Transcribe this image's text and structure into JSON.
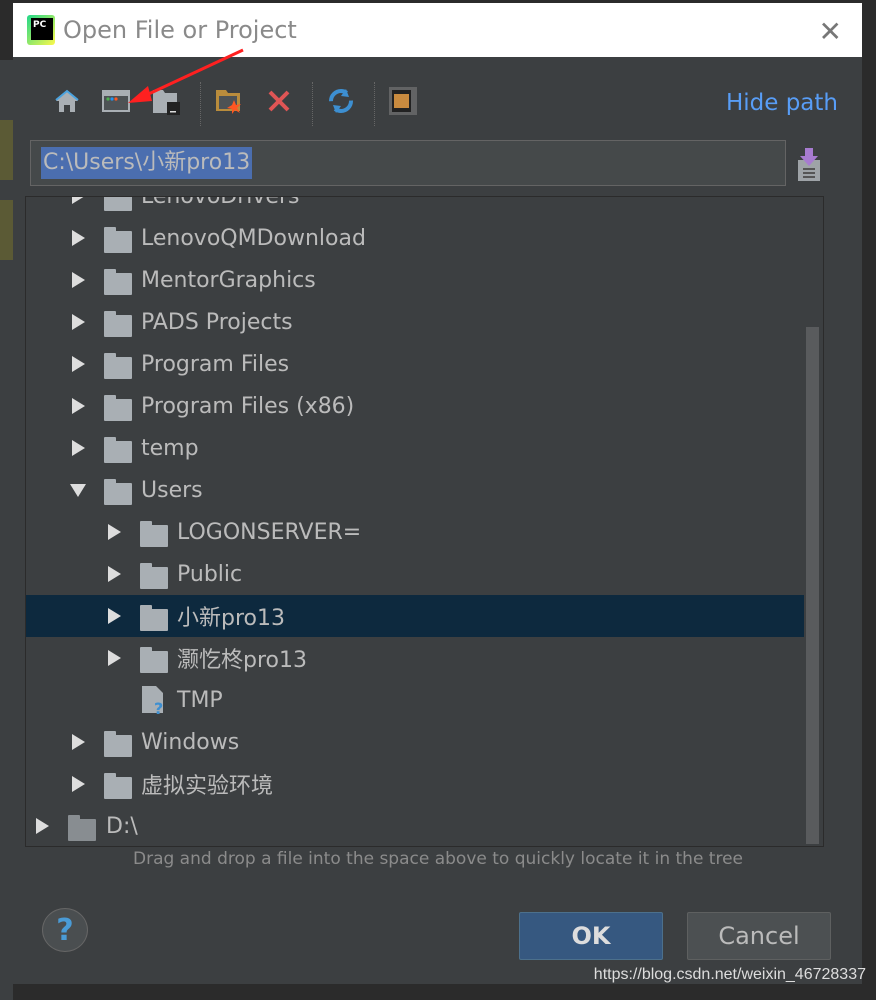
{
  "dialog": {
    "title": "Open File or Project",
    "close_icon": "close-icon"
  },
  "toolbar": {
    "hide_path_label": "Hide path",
    "buttons": [
      "home",
      "desktop",
      "project-folder",
      "new-folder",
      "delete",
      "refresh",
      "show-hidden"
    ]
  },
  "path": {
    "value": "C:\\Users\\小新pro13"
  },
  "tree": {
    "rows": [
      {
        "label": "LenovoDrivers",
        "level": 1,
        "expanded": false,
        "type": "folder"
      },
      {
        "label": "LenovoQMDownload",
        "level": 1,
        "expanded": false,
        "type": "folder"
      },
      {
        "label": "MentorGraphics",
        "level": 1,
        "expanded": false,
        "type": "folder"
      },
      {
        "label": "PADS Projects",
        "level": 1,
        "expanded": false,
        "type": "folder"
      },
      {
        "label": "Program Files",
        "level": 1,
        "expanded": false,
        "type": "folder"
      },
      {
        "label": "Program Files (x86)",
        "level": 1,
        "expanded": false,
        "type": "folder"
      },
      {
        "label": "temp",
        "level": 1,
        "expanded": false,
        "type": "folder"
      },
      {
        "label": "Users",
        "level": 1,
        "expanded": true,
        "type": "folder"
      },
      {
        "label": "LOGONSERVER=",
        "level": 2,
        "expanded": false,
        "type": "folder"
      },
      {
        "label": "Public",
        "level": 2,
        "expanded": false,
        "type": "folder"
      },
      {
        "label": "小新pro13",
        "level": 2,
        "expanded": false,
        "type": "folder",
        "selected": true
      },
      {
        "label": "灏忔柊pro13",
        "level": 2,
        "expanded": false,
        "type": "folder"
      },
      {
        "label": "TMP",
        "level": 2,
        "type": "unknown-file"
      },
      {
        "label": "Windows",
        "level": 1,
        "expanded": false,
        "type": "folder"
      },
      {
        "label": "虚拟实验环境",
        "level": 1,
        "expanded": false,
        "type": "folder"
      },
      {
        "label": "D:\\",
        "level": 0,
        "expanded": false,
        "type": "drive"
      }
    ]
  },
  "hint": "Drag and drop a file into the space above to quickly locate it in the tree",
  "buttons": {
    "ok": "OK",
    "cancel": "Cancel",
    "help": "?"
  },
  "watermark": "https://blog.csdn.net/weixin_46728337",
  "colors": {
    "accent": "#589df6",
    "selection": "#0d293e",
    "ok": "#365880",
    "annotation_arrow": "#ff2020"
  }
}
